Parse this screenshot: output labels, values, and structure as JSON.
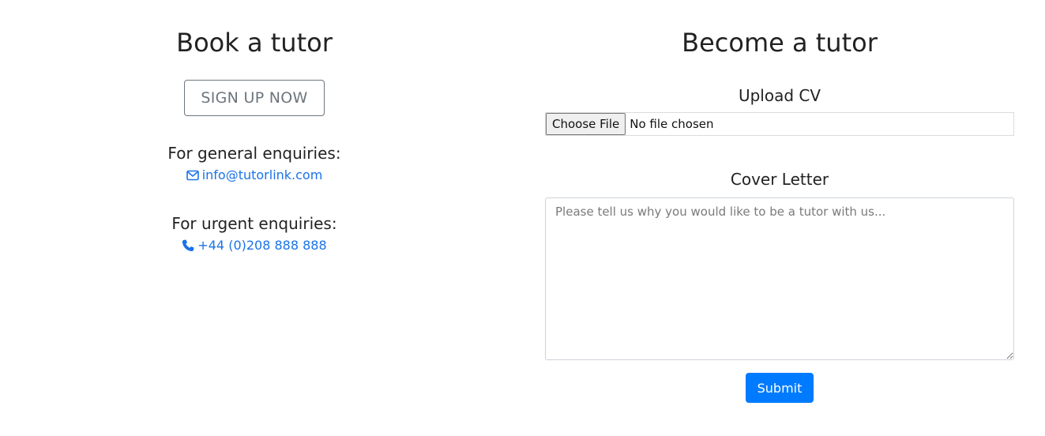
{
  "book": {
    "title": "Book a tutor",
    "signup_label": "SIGN UP NOW",
    "general_label": "For general enquiries:",
    "email": "info@tutorlink.com",
    "urgent_label": "For urgent enquiries:",
    "phone": "+44 (0)208 888 888"
  },
  "become": {
    "title": "Become a tutor",
    "upload_label": "Upload CV",
    "choose_file_label": "Choose File",
    "file_status": "No file chosen",
    "cover_label": "Cover Letter",
    "cover_placeholder": "Please tell us why you would like to be a tutor with us...",
    "submit_label": "Submit"
  },
  "icons": {
    "email": "envelope-icon",
    "phone": "phone-icon"
  },
  "colors": {
    "link": "#1a73e8",
    "primary": "#007bff",
    "secondary": "#6c757d"
  }
}
